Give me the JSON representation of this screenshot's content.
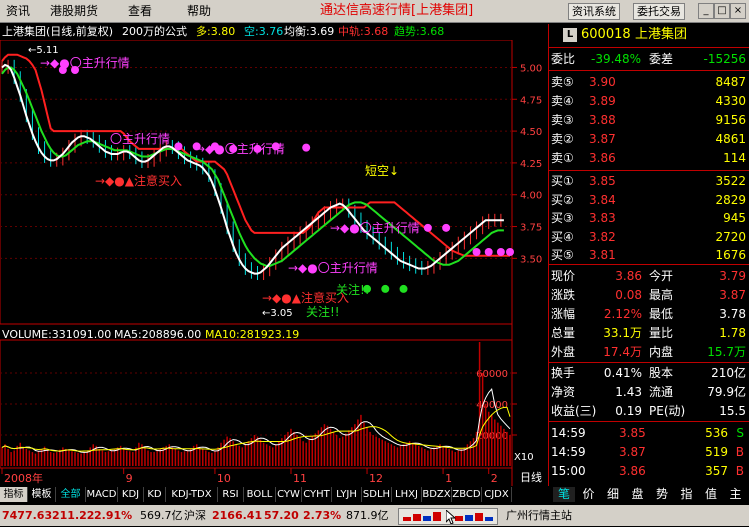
{
  "menu": {
    "items": [
      "资讯",
      "港股期货",
      "查看",
      "帮助"
    ],
    "app_title": "通达信高速行情[上港集团]",
    "btn_info": "资讯系统",
    "btn_trade": "委托交易",
    "win_min": "_",
    "win_max": "□",
    "win_close": "×"
  },
  "info": {
    "name": "上港集团(日线,前复权)",
    "formula": "200万的公式",
    "duo": "多:3.80",
    "kong": "空:3.76",
    "junheng": "均衡:3.69",
    "zhonggui": "中轨:3.68",
    "qushi": "趋势:3.68"
  },
  "chart_annotations": {
    "high_label": "←5.11",
    "low_label": "←3.05",
    "note1": "→◆●〇主升行情",
    "note2": "→◆●▲注意买入",
    "note3": "〇主升行情",
    "note4": "→◆●〇主升行情",
    "note5": "→◆●〇主升行情",
    "note6": "→◆●▲注意买入",
    "note7": "关注!!",
    "note8": "短空↓",
    "note9": "关注!!",
    "ma_legend": {
      "volume": "VOLUME:331091.00",
      "ma5": "MA5:208896.00",
      "ma10": "MA10:281923.19"
    },
    "vol_unit": "X10",
    "period": "日线"
  },
  "chart_data": [
    {
      "type": "line",
      "title": "",
      "xlabel": "",
      "ylabel": "",
      "ylim": [
        3.0,
        5.2
      ],
      "y_ticks": [
        "5.00",
        "4.75",
        "4.50",
        "4.25",
        "4.00",
        "3.75",
        "3.50"
      ],
      "y_tick_values": [
        5.0,
        4.75,
        4.5,
        4.25,
        4.0,
        3.75,
        3.5
      ],
      "x_ticks": [
        "2008年",
        "9",
        "10",
        "11",
        "12",
        "1",
        "2"
      ],
      "x_tick_index": [
        0,
        40,
        70,
        95,
        120,
        145,
        160
      ],
      "n": 168,
      "series": [
        {
          "color": "#ff2020",
          "values": [
            5.05,
            5.08,
            5.1,
            5.1,
            5.1,
            5.1,
            5.09,
            5.08,
            5.07,
            5.05,
            5.02,
            4.98,
            4.9,
            4.82,
            4.72,
            4.62,
            4.52,
            4.5,
            4.5,
            4.5,
            4.5,
            4.5,
            4.5,
            4.5,
            4.5,
            4.5,
            4.5,
            4.5,
            4.5,
            4.5,
            4.5,
            4.5,
            4.5,
            4.5,
            4.5,
            4.5,
            4.5,
            4.5,
            4.5,
            4.5,
            4.48,
            4.45,
            4.42,
            4.4,
            4.38,
            4.36,
            4.36,
            4.36,
            4.36,
            4.36,
            4.36,
            4.36,
            4.36,
            4.36,
            4.36,
            4.36,
            4.36,
            4.36,
            4.36,
            4.36,
            4.34,
            4.32,
            4.3,
            4.28,
            4.26,
            4.26,
            4.26,
            4.26,
            4.26,
            4.26,
            4.26,
            4.24,
            4.22,
            4.2,
            4.16,
            4.1,
            4.04,
            3.98,
            3.92,
            3.86,
            3.8,
            3.76,
            3.72,
            3.7,
            3.7,
            3.7,
            3.7,
            3.7,
            3.7,
            3.7,
            3.7,
            3.7,
            3.7,
            3.7,
            3.7,
            3.7,
            3.7,
            3.7,
            3.7,
            3.7,
            3.72,
            3.74,
            3.78,
            3.82,
            3.86,
            3.88,
            3.9,
            3.9,
            3.9,
            3.9,
            3.9,
            3.9,
            3.9,
            3.9,
            3.9,
            3.9,
            3.9,
            3.9,
            3.9,
            3.9,
            3.92,
            3.94,
            3.94,
            3.94,
            3.94,
            3.94,
            3.94,
            3.94,
            3.94,
            3.94,
            3.92,
            3.9,
            3.88,
            3.86,
            3.84,
            3.82,
            3.8,
            3.78,
            3.76,
            3.74,
            3.72,
            3.7,
            3.68,
            3.66,
            3.64,
            3.62,
            3.6,
            3.58,
            3.56,
            3.55,
            3.54,
            3.53,
            3.52,
            3.52,
            3.52,
            3.52,
            3.52,
            3.52,
            3.52,
            3.52,
            3.52,
            3.52,
            3.52,
            3.52,
            3.52,
            3.52,
            3.52,
            3.52
          ]
        },
        {
          "color": "#20e020",
          "values": [
            4.95,
            4.98,
            5.0,
            5.0,
            4.98,
            4.95,
            4.9,
            4.85,
            4.8,
            4.74,
            4.68,
            4.62,
            4.56,
            4.5,
            4.45,
            4.4,
            4.36,
            4.33,
            4.31,
            4.3,
            4.3,
            4.31,
            4.33,
            4.35,
            4.37,
            4.39,
            4.4,
            4.41,
            4.42,
            4.42,
            4.42,
            4.41,
            4.4,
            4.39,
            4.38,
            4.37,
            4.36,
            4.35,
            4.35,
            4.35,
            4.35,
            4.35,
            4.34,
            4.33,
            4.32,
            4.31,
            4.3,
            4.3,
            4.3,
            4.31,
            4.32,
            4.33,
            4.34,
            4.35,
            4.36,
            4.36,
            4.36,
            4.35,
            4.34,
            4.33,
            4.32,
            4.31,
            4.3,
            4.29,
            4.28,
            4.27,
            4.26,
            4.24,
            4.22,
            4.2,
            4.16,
            4.12,
            4.06,
            4.0,
            3.94,
            3.88,
            3.82,
            3.76,
            3.7,
            3.65,
            3.6,
            3.56,
            3.53,
            3.5,
            3.48,
            3.46,
            3.45,
            3.44,
            3.44,
            3.45,
            3.46,
            3.47,
            3.48,
            3.5,
            3.52,
            3.54,
            3.56,
            3.58,
            3.6,
            3.62,
            3.64,
            3.66,
            3.68,
            3.7,
            3.72,
            3.74,
            3.76,
            3.78,
            3.8,
            3.82,
            3.84,
            3.86,
            3.88,
            3.9,
            3.92,
            3.93,
            3.94,
            3.94,
            3.94,
            3.93,
            3.92,
            3.9,
            3.88,
            3.86,
            3.84,
            3.82,
            3.8,
            3.78,
            3.76,
            3.74,
            3.72,
            3.7,
            3.68,
            3.66,
            3.64,
            3.62,
            3.6,
            3.58,
            3.56,
            3.54,
            3.52,
            3.5,
            3.48,
            3.47,
            3.46,
            3.45,
            3.45,
            3.45,
            3.46,
            3.47,
            3.48,
            3.5,
            3.52,
            3.54,
            3.56,
            3.58,
            3.6,
            3.62,
            3.64,
            3.66,
            3.68,
            3.7,
            3.71,
            3.72,
            3.72,
            3.72
          ]
        },
        {
          "color": "#ffffff",
          "values": [
            5.0,
            5.02,
            5.01,
            4.98,
            4.92,
            4.85,
            4.78,
            4.7,
            4.62,
            4.55,
            4.48,
            4.42,
            4.37,
            4.33,
            4.3,
            4.28,
            4.27,
            4.27,
            4.28,
            4.3,
            4.32,
            4.35,
            4.38,
            4.41,
            4.43,
            4.45,
            4.46,
            4.46,
            4.45,
            4.44,
            4.42,
            4.4,
            4.38,
            4.36,
            4.34,
            4.33,
            4.32,
            4.32,
            4.32,
            4.33,
            4.34,
            4.34,
            4.33,
            4.31,
            4.29,
            4.27,
            4.26,
            4.26,
            4.27,
            4.29,
            4.31,
            4.33,
            4.35,
            4.37,
            4.38,
            4.38,
            4.37,
            4.35,
            4.33,
            4.31,
            4.29,
            4.27,
            4.26,
            4.25,
            4.24,
            4.23,
            4.21,
            4.18,
            4.15,
            4.1,
            4.04,
            3.97,
            3.9,
            3.82,
            3.74,
            3.67,
            3.6,
            3.54,
            3.49,
            3.45,
            3.42,
            3.4,
            3.39,
            3.38,
            3.38,
            3.39,
            3.41,
            3.43,
            3.46,
            3.49,
            3.52,
            3.55,
            3.58,
            3.6,
            3.62,
            3.64,
            3.66,
            3.68,
            3.7,
            3.72,
            3.74,
            3.76,
            3.78,
            3.8,
            3.82,
            3.84,
            3.86,
            3.88,
            3.9,
            3.91,
            3.92,
            3.93,
            3.92,
            3.9,
            3.87,
            3.84,
            3.81,
            3.78,
            3.75,
            3.72,
            3.7,
            3.68,
            3.66,
            3.64,
            3.62,
            3.6,
            3.58,
            3.56,
            3.54,
            3.52,
            3.5,
            3.48,
            3.47,
            3.46,
            3.45,
            3.44,
            3.43,
            3.42,
            3.42,
            3.42,
            3.43,
            3.44,
            3.46,
            3.48,
            3.5,
            3.52,
            3.54,
            3.56,
            3.58,
            3.6,
            3.62,
            3.64,
            3.66,
            3.68,
            3.7,
            3.72,
            3.74,
            3.76,
            3.78,
            3.8,
            3.8,
            3.8,
            3.8,
            3.8,
            3.8,
            3.8
          ]
        }
      ]
    },
    {
      "type": "bar",
      "title": "",
      "ylim": [
        0,
        80000
      ],
      "y_ticks": [
        "60000",
        "40000",
        "20000"
      ],
      "y_tick_values": [
        60000,
        40000,
        20000
      ],
      "bar_color": "#c00000",
      "values": [
        12000,
        14000,
        11000,
        9000,
        10000,
        13000,
        15000,
        12000,
        11000,
        10000,
        9000,
        8000,
        9500,
        11000,
        12500,
        10000,
        9000,
        8500,
        9000,
        10500,
        12000,
        11000,
        10000,
        9500,
        9000,
        8500,
        8000,
        9000,
        10000,
        12000,
        14000,
        13000,
        11000,
        10000,
        9000,
        9500,
        10000,
        11000,
        12000,
        13000,
        11000,
        10000,
        9500,
        9000,
        12000,
        15000,
        14000,
        12000,
        10000,
        9000,
        9000,
        10000,
        11000,
        12000,
        13000,
        14000,
        12000,
        11000,
        10000,
        9000,
        9500,
        10000,
        11000,
        13000,
        14000,
        12000,
        11000,
        10000,
        9000,
        8500,
        10000,
        12000,
        15000,
        17000,
        19000,
        18000,
        16000,
        14000,
        13000,
        12000,
        14000,
        16000,
        18000,
        20000,
        19000,
        17000,
        15000,
        14000,
        13000,
        12000,
        14000,
        16000,
        18000,
        20000,
        22000,
        24000,
        22000,
        20000,
        18000,
        16000,
        15000,
        17000,
        19000,
        21000,
        23000,
        25000,
        27000,
        26000,
        24000,
        22000,
        20000,
        18000,
        19000,
        21000,
        23000,
        25000,
        27000,
        30000,
        33000,
        28000,
        25000,
        22000,
        20000,
        19000,
        18000,
        17000,
        16000,
        15000,
        14000,
        13000,
        12000,
        13000,
        14000,
        15000,
        16000,
        15000,
        14000,
        13000,
        12000,
        11000,
        10000,
        11000,
        12000,
        13000,
        14000,
        13000,
        12000,
        11000,
        10000,
        9000,
        10000,
        11000,
        12000,
        14000,
        16000,
        18000,
        22000,
        80000,
        60000,
        40000,
        35000,
        33091,
        30000,
        28000,
        26000,
        24000,
        22000,
        20000
      ]
    }
  ],
  "right_panel": {
    "code": "600018",
    "name": "上港集团",
    "weibi_label": "委比",
    "weibi_value": "-39.48%",
    "weicha_label": "委差",
    "weicha_value": "-15256",
    "asks": [
      {
        "label": "卖⑤",
        "price": "3.90",
        "vol": "8487"
      },
      {
        "label": "卖④",
        "price": "3.89",
        "vol": "4330"
      },
      {
        "label": "卖③",
        "price": "3.88",
        "vol": "9156"
      },
      {
        "label": "卖②",
        "price": "3.87",
        "vol": "4861"
      },
      {
        "label": "卖①",
        "price": "3.86",
        "vol": "114"
      }
    ],
    "bids": [
      {
        "label": "买①",
        "price": "3.85",
        "vol": "3522"
      },
      {
        "label": "买②",
        "price": "3.84",
        "vol": "2829"
      },
      {
        "label": "买③",
        "price": "3.83",
        "vol": "945"
      },
      {
        "label": "买④",
        "price": "3.82",
        "vol": "2720"
      },
      {
        "label": "买⑤",
        "price": "3.81",
        "vol": "1676"
      }
    ],
    "stats": [
      {
        "l1": "现价",
        "v1": "3.86",
        "l2": "今开",
        "v2": "3.79"
      },
      {
        "l1": "涨跌",
        "v1": "0.08",
        "l2": "最高",
        "v2": "3.87"
      },
      {
        "l1": "涨幅",
        "v1": "2.12%",
        "l2": "最低",
        "v2": "3.78"
      },
      {
        "l1": "总量",
        "v1": "33.1万",
        "l2": "量比",
        "v2": "1.78"
      },
      {
        "l1": "外盘",
        "v1": "17.4万",
        "l2": "内盘",
        "v2": "15.7万"
      }
    ],
    "fin": [
      {
        "l1": "换手",
        "v1": "0.41%",
        "l2": "股本",
        "v2": "210亿"
      },
      {
        "l1": "净资",
        "v1": "1.43",
        "l2": "流通",
        "v2": "79.9亿"
      },
      {
        "l1": "收益(三)",
        "v1": "0.19",
        "l2": "PE(动)",
        "v2": "15.5"
      }
    ],
    "ticks": [
      {
        "time": "14:59",
        "price": "3.85",
        "vol": "536",
        "side": "S"
      },
      {
        "time": "14:59",
        "price": "3.87",
        "vol": "519",
        "side": "B"
      },
      {
        "time": "15:00",
        "price": "3.86",
        "vol": "357",
        "side": "B"
      }
    ]
  },
  "tabs": [
    "指标",
    "模板",
    "全部",
    "MACD",
    "KDJ",
    "KD",
    "KDJ-TDX",
    "RSI",
    "BOLL",
    "CYW",
    "CYHT",
    "LYJH",
    "SDLH",
    "LHXJ",
    "BDZX",
    "ZBCD",
    "CJDX"
  ],
  "right_tabs": [
    "笔",
    "价",
    "细",
    "盘",
    "势",
    "指",
    "值",
    "主"
  ],
  "status": {
    "index1_value": "7477.63",
    "index1_change": "211.22",
    "index1_pct": "2.91%",
    "index1_amount": "569.7亿",
    "index2_name": "沪深",
    "index2_value": "2166.41",
    "index2_change": "57.20",
    "index2_pct": "2.73%",
    "index2_amount": "871.9亿",
    "station": "广州行情主站"
  },
  "colors": {
    "up": "#ff3030",
    "down": "#00e000",
    "accent": "#ffff00",
    "border": "#c00000"
  }
}
